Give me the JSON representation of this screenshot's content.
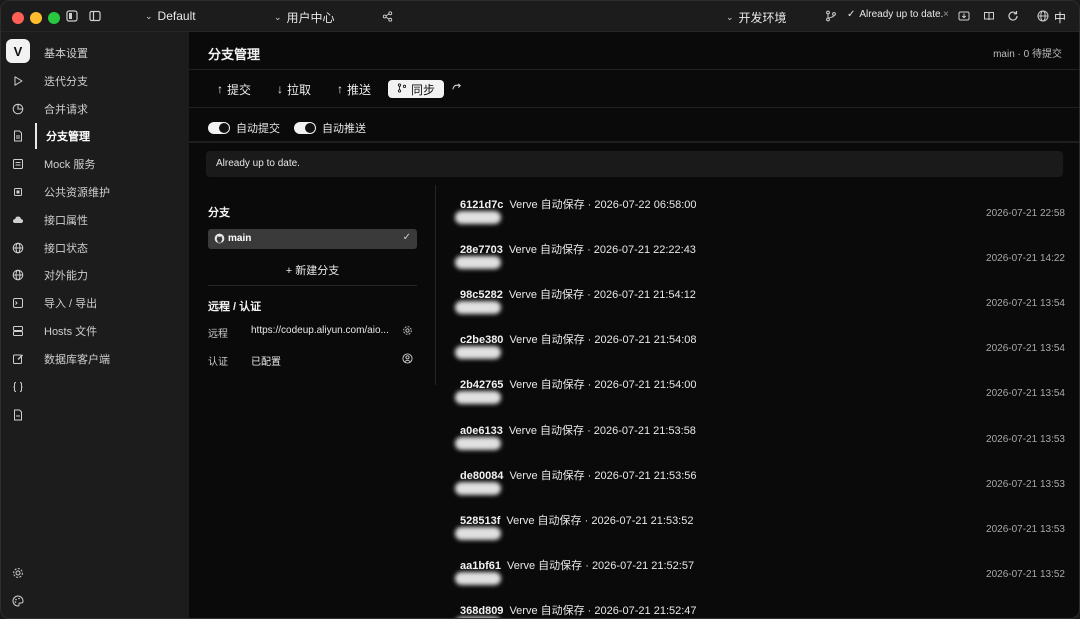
{
  "titlebar": {
    "workspace": "Default",
    "collection": "用户中心",
    "environment": "开发环境",
    "status": "Already up to date.",
    "language": "中",
    "close_symbol": "×"
  },
  "sidebar": {
    "logo": "V",
    "items": [
      {
        "label": "基本设置",
        "icon": "grid-icon"
      },
      {
        "label": "迭代分支",
        "icon": "play-icon"
      },
      {
        "label": "合并请求",
        "icon": "pie-icon"
      },
      {
        "label": "分支管理",
        "icon": "document-icon",
        "active": true
      },
      {
        "label": "Mock 服务",
        "icon": "list-icon"
      },
      {
        "label": "公共资源维护",
        "icon": "chip-icon"
      },
      {
        "label": "接口属性",
        "icon": "cloud-icon"
      },
      {
        "label": "接口状态",
        "icon": "globe-icon"
      },
      {
        "label": "对外能力",
        "icon": "globe-icon"
      },
      {
        "label": "导入 / 导出",
        "icon": "terminal-icon"
      },
      {
        "label": "Hosts 文件",
        "icon": "server-icon"
      },
      {
        "label": "数据库客户端",
        "icon": "edit-icon"
      }
    ]
  },
  "header": {
    "title": "分支管理",
    "branch_info": "main · 0 待提交"
  },
  "toolbar": {
    "commit": "提交",
    "pull": "拉取",
    "push": "推送",
    "sync": "同步"
  },
  "toggles": {
    "auto_commit": "自动提交",
    "auto_push": "自动推送"
  },
  "notice": "Already up to date.",
  "branches": {
    "title": "分支",
    "current": "main",
    "new_branch": "+ 新建分支"
  },
  "remote": {
    "title": "远程 / 认证",
    "remote_label": "远程",
    "remote_value": "https://codeup.aliyun.com/aio...",
    "auth_label": "认证",
    "auth_value": "已配置"
  },
  "commits": [
    {
      "hash": "6121d7c",
      "message": "Verve 自动保存 · 2026-07-22 06:58:00",
      "date": "2026-07-21 22:58"
    },
    {
      "hash": "28e7703",
      "message": "Verve 自动保存 · 2026-07-21 22:22:43",
      "date": "2026-07-21 14:22"
    },
    {
      "hash": "98c5282",
      "message": "Verve 自动保存 · 2026-07-21 21:54:12",
      "date": "2026-07-21 13:54"
    },
    {
      "hash": "c2be380",
      "message": "Verve 自动保存 · 2026-07-21 21:54:08",
      "date": "2026-07-21 13:54"
    },
    {
      "hash": "2b42765",
      "message": "Verve 自动保存 · 2026-07-21 21:54:00",
      "date": "2026-07-21 13:54"
    },
    {
      "hash": "a0e6133",
      "message": "Verve 自动保存 · 2026-07-21 21:53:58",
      "date": "2026-07-21 13:53"
    },
    {
      "hash": "de80084",
      "message": "Verve 自动保存 · 2026-07-21 21:53:56",
      "date": "2026-07-21 13:53"
    },
    {
      "hash": "528513f",
      "message": "Verve 自动保存 · 2026-07-21 21:53:52",
      "date": "2026-07-21 13:53"
    },
    {
      "hash": "aa1bf61",
      "message": "Verve 自动保存 · 2026-07-21 21:52:57",
      "date": "2026-07-21 13:52"
    },
    {
      "hash": "368d809",
      "message": "Verve 自动保存 · 2026-07-21 21:52:47",
      "date": ""
    }
  ]
}
